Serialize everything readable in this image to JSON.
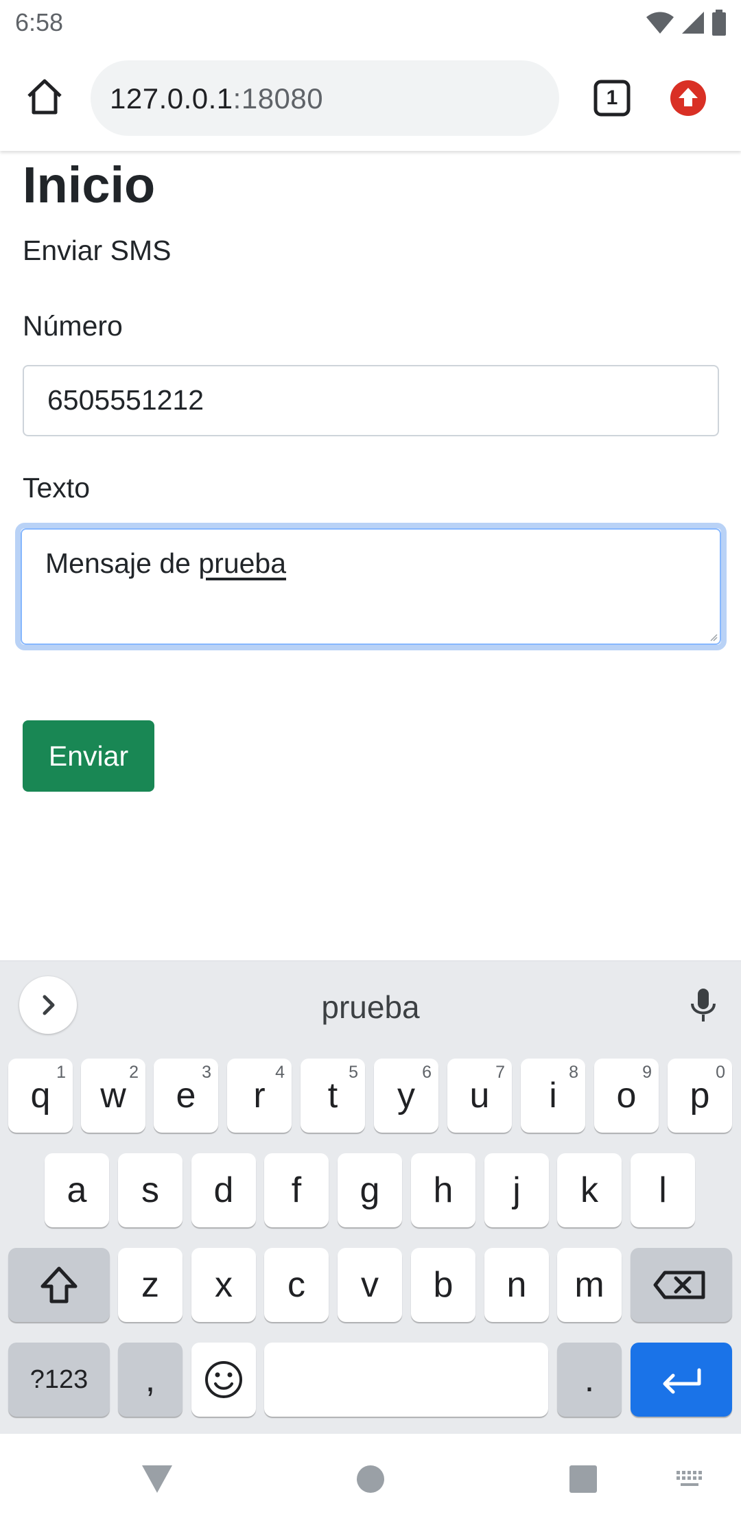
{
  "status_bar": {
    "time": "6:58"
  },
  "browser": {
    "url_host": "127.0.0.1",
    "url_port": ":18080",
    "tab_count": "1"
  },
  "page": {
    "title": "Inicio",
    "subtitle": "Enviar SMS",
    "number_label": "Número",
    "number_value": "6505551212",
    "text_label": "Texto",
    "text_value_prefix": "Mensaje de ",
    "text_value_word": "prueba",
    "send_label": "Enviar"
  },
  "keyboard": {
    "suggestion": "prueba",
    "row1": [
      {
        "key": "q",
        "sup": "1"
      },
      {
        "key": "w",
        "sup": "2"
      },
      {
        "key": "e",
        "sup": "3"
      },
      {
        "key": "r",
        "sup": "4"
      },
      {
        "key": "t",
        "sup": "5"
      },
      {
        "key": "y",
        "sup": "6"
      },
      {
        "key": "u",
        "sup": "7"
      },
      {
        "key": "i",
        "sup": "8"
      },
      {
        "key": "o",
        "sup": "9"
      },
      {
        "key": "p",
        "sup": "0"
      }
    ],
    "row2": [
      "a",
      "s",
      "d",
      "f",
      "g",
      "h",
      "j",
      "k",
      "l"
    ],
    "row3": [
      "z",
      "x",
      "c",
      "v",
      "b",
      "n",
      "m"
    ],
    "symbols_label": "?123",
    "comma_label": ",",
    "period_label": "."
  },
  "colors": {
    "accent_blue": "#1a73e8",
    "send_button": "#198754",
    "focus_ring": "#86b7fe",
    "update_badge": "#d93025"
  }
}
